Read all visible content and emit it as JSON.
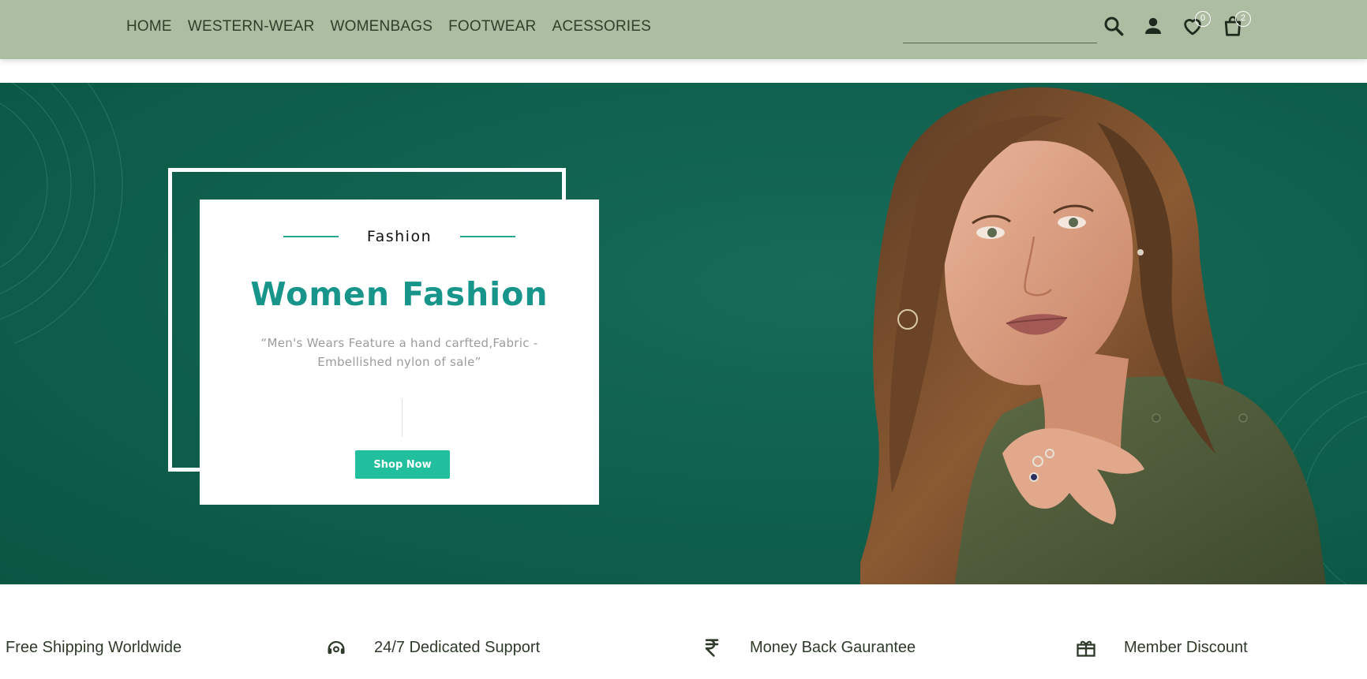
{
  "nav": {
    "items": [
      {
        "label": "HOME"
      },
      {
        "label": "WESTERN-WEAR"
      },
      {
        "label": "WOMENBAGS"
      },
      {
        "label": "FOOTWEAR"
      },
      {
        "label": "ACESSORIES"
      }
    ]
  },
  "search": {
    "value": "",
    "placeholder": ""
  },
  "header_icons": {
    "search": "search-icon",
    "account": "user-icon",
    "wishlist": "heart-icon",
    "cart": "shopping-bag-icon",
    "wishlist_count": "0",
    "cart_count": "2"
  },
  "hero": {
    "kicker": "Fashion",
    "title": "Women Fashion",
    "quote": "“Men's Wears Feature a hand carfted,Fabric - Embellished nylon of sale”",
    "cta": "Shop Now"
  },
  "features": [
    {
      "icon": "shipping-icon",
      "label": "Free Shipping Worldwide"
    },
    {
      "icon": "support-headset-icon",
      "label": "24/7 Dedicated Support"
    },
    {
      "icon": "rupee-icon",
      "label": "Money Back Gaurantee"
    },
    {
      "icon": "gift-icon",
      "label": "Member Discount"
    }
  ],
  "colors": {
    "header_bg": "#adbda1",
    "hero_bg": "#0f5f4d",
    "accent": "#21bf9d",
    "title": "#17958a"
  }
}
